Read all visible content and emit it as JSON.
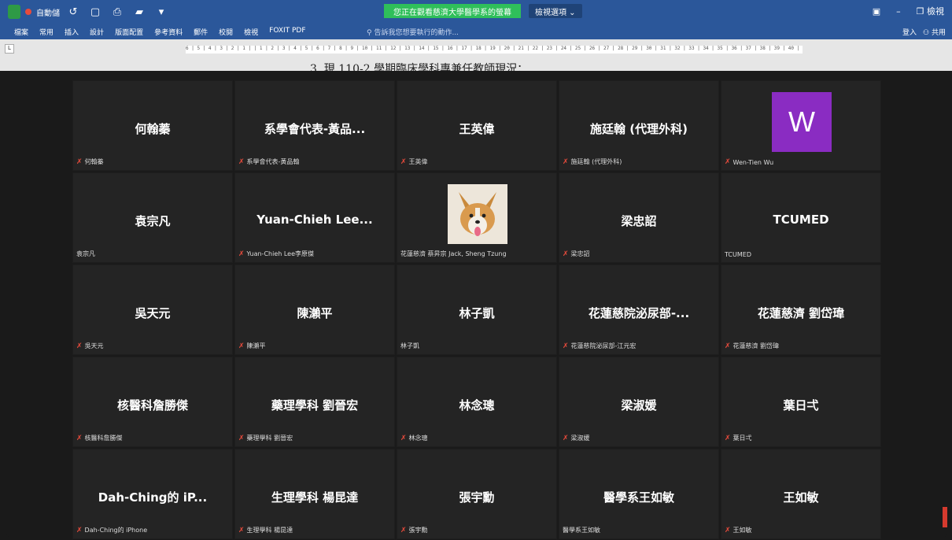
{
  "word": {
    "titlebar": {
      "autosave": "自動儲",
      "share_banner": "您正在觀看慈濟大學醫學系的螢幕",
      "view_options": "檢視選項 ⌄",
      "right_mini": "檢視"
    },
    "ribbon": {
      "tabs": [
        "檔案",
        "常用",
        "插入",
        "設計",
        "版面配置",
        "參考資料",
        "郵件",
        "校閱",
        "檢視",
        "FOXIT PDF"
      ],
      "tell_me": "告訴我您想要執行的動作...",
      "sign_in": "登入",
      "share": "共用"
    },
    "ruler_text": "6 | 5 | 4 | 3 | 2 | 1 |  | 1 | 2 | 3 | 4 | 5 | 6 | 7 | 8 | 9 | 10 | 11 | 12 | 13 | 14 | 15 | 16 | 17 | 18 | 19 | 20 | 21 | 22 | 23 | 24 | 25 | 26 | 27 | 28 | 29 | 30 | 31 | 32 | 33 | 34 | 35 | 36 | 37 | 38 | 39 | 40 | 41 | 42 | 43 |",
    "left_ruler": "L",
    "doc_heading": "3. 現 110-2 學期臨床學科專兼任教師現況："
  },
  "participants": [
    {
      "display": "何翰蓁",
      "label": "何翰蓁",
      "muted": true
    },
    {
      "display": "系學會代表-黃品...",
      "label": "系學會代表-黃品翰",
      "muted": true
    },
    {
      "display": "王英偉",
      "label": "王英偉",
      "muted": true
    },
    {
      "display": "施廷翰 (代理外科)",
      "label": "施廷翰 (代理外科)",
      "muted": true
    },
    {
      "display": "W",
      "label": "Wen-Tien Wu",
      "muted": true,
      "avatar": "letter",
      "avatar_color": "#8a2cc2"
    },
    {
      "display": "袁宗凡",
      "label": "袁宗凡",
      "muted": false
    },
    {
      "display": "Yuan-Chieh  Lee...",
      "label": "Yuan-Chieh Lee李原傑",
      "muted": true
    },
    {
      "display": "",
      "label": "花蓮慈濟 蔡昇宗 Jack, Sheng Tzung",
      "muted": false,
      "avatar": "dog-photo"
    },
    {
      "display": "梁忠詔",
      "label": "梁忠詔",
      "muted": true
    },
    {
      "display": "TCUMED",
      "label": "TCUMED",
      "muted": false
    },
    {
      "display": "吳天元",
      "label": "吳天元",
      "muted": true
    },
    {
      "display": "陳瀨平",
      "label": "陳瀨平",
      "muted": true
    },
    {
      "display": "林子凱",
      "label": "林子凱",
      "muted": false
    },
    {
      "display": "花蓮慈院泌尿部-...",
      "label": "花蓮慈院泌尿部-江元宏",
      "muted": true
    },
    {
      "display": "花蓮慈濟 劉岱瑋",
      "label": "花蓮慈濟 劉岱瑋",
      "muted": true
    },
    {
      "display": "核醫科詹勝傑",
      "label": "核醫科詹勝傑",
      "muted": true
    },
    {
      "display": "藥理學科 劉晉宏",
      "label": "藥理學科 劉晉宏",
      "muted": true
    },
    {
      "display": "林念璁",
      "label": "林念璁",
      "muted": true
    },
    {
      "display": "梁淑媛",
      "label": "梁淑媛",
      "muted": true
    },
    {
      "display": "葉日弌",
      "label": "葉日弌",
      "muted": true
    },
    {
      "display": "Dah-Ching的 iP...",
      "label": "Dah-Ching的 iPhone",
      "muted": true
    },
    {
      "display": "生理學科 楊昆達",
      "label": "生理學科 楊昆達",
      "muted": true
    },
    {
      "display": "張宇勳",
      "label": "張宇勳",
      "muted": true
    },
    {
      "display": "醫學系王如敏",
      "label": "醫學系王如敏",
      "muted": false
    },
    {
      "display": "王如敏",
      "label": "王如敏",
      "muted": true
    }
  ],
  "icons": {
    "muted": "mic-muted-icon",
    "record": "record-icon",
    "shield": "shield-icon"
  }
}
